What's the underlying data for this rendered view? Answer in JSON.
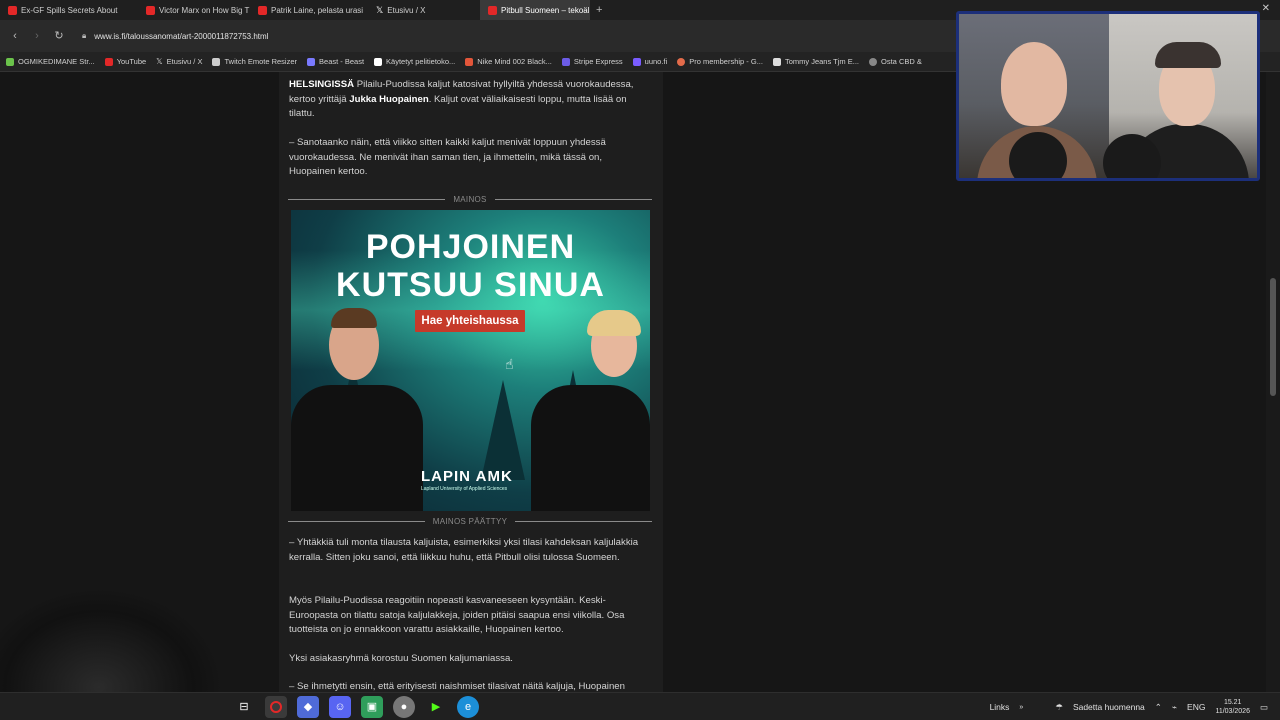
{
  "tabs": [
    {
      "title": "Ex-GF Spills Secrets About",
      "color": "#e32828"
    },
    {
      "title": "Victor Marx on How Big T",
      "color": "#e32828"
    },
    {
      "title": "Patrik Laine, pelasta urasi",
      "color": "#e32828"
    },
    {
      "title": "Etusivu / X",
      "color": "#ffffff"
    },
    {
      "title": "Pitbull Suomeen – tekoäl",
      "color": "#e32828",
      "active": true
    }
  ],
  "new_tab": "+",
  "address": {
    "url": "www.is.fi/taloussanomat/art-2000011872753.html"
  },
  "bookmarks": [
    {
      "label": "OGMIKEDIMANE Str...",
      "color": "#6bc34b"
    },
    {
      "label": "YouTube",
      "color": "#e32828"
    },
    {
      "label": "Etusivu / X",
      "color": "#ffffff"
    },
    {
      "label": "Twitch Emote Resizer",
      "color": "#cccccc"
    },
    {
      "label": "Beast - Beast",
      "color": "#7a7aff"
    },
    {
      "label": "Käytetyt pelitietoko...",
      "color": "#ffffff"
    },
    {
      "label": "Nike Mind 002 Black...",
      "color": "#e3563a"
    },
    {
      "label": "Stripe Express",
      "color": "#6c5ce7"
    },
    {
      "label": "uuno.fi",
      "color": "#7a5cff"
    },
    {
      "label": "Pro membership - G...",
      "color": "#e36b4a"
    },
    {
      "label": "Tommy Jeans Tjm E...",
      "color": "#dddddd"
    },
    {
      "label": "Osta CBD &",
      "color": "#888888"
    }
  ],
  "article": {
    "para1_lead": "HELSINGISSÄ",
    "para1_rest": " Pilailu-Puodissa kaljut katosivat hyllyiltä yhdessä vuorokaudessa, kertoo yrittäjä ",
    "para1_name": "Jukka Huopainen",
    "para1_tail": ". Kaljut ovat väliaikaisesti loppu, mutta lisää on tilattu.",
    "para2": "– Sanotaanko näin, että viikko sitten kaikki kaljut menivät loppuun yhdessä vuorokaudessa. Ne menivät ihan saman tien, ja ihmettelin, mikä tässä on, Huopainen kertoo.",
    "ad_label": "MAINOS",
    "ad_end_label": "MAINOS PÄÄTTYY",
    "para3": "– Yhtäkkiä tuli monta tilausta kaljuista, esimerkiksi yksi tilasi kahdeksan kaljulakkia kerralla. Sitten joku sanoi, että liikkuu huhu, että Pitbull olisi tulossa Suomeen.",
    "para4": "Myös Pilailu-Puodissa reagoitiin nopeasti kasvaneeseen kysyntään. Keski-Euroopasta on tilattu satoja kaljulakkeja, joiden pitäisi saapua ensi viikolla. Osa tuotteista on jo ennakkoon varattu asiakkaille, Huopainen kertoo.",
    "para5": "Yksi asiakasryhmä korostuu Suomen kaljumaniassa.",
    "para6": "– Se ihmetytti ensin, että erityisesti naishmiset tilasivat näitä kaljuja, Huopainen"
  },
  "ad": {
    "headline_line1": "POHJOINEN",
    "headline_line2": "KUTSUU SINUA",
    "cta": "Hae yhteishaussa",
    "brand": "LAPIN AMK",
    "brand_sub": "Lapland University of Applied Sciences"
  },
  "taskbar": {
    "links": "Links",
    "weather": "Sadetta huomenna",
    "language": "ENG",
    "time": "15.21",
    "date": "11/03/2026"
  }
}
